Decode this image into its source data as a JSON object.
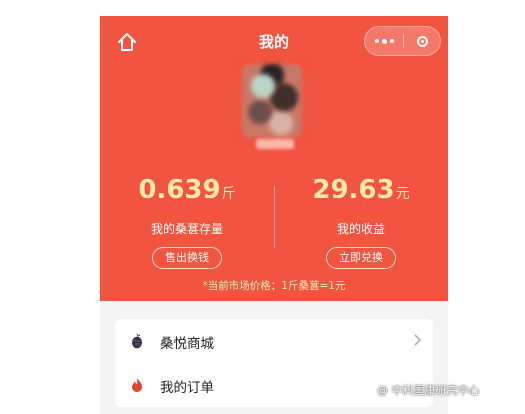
{
  "header": {
    "title": "我的"
  },
  "stats": {
    "storage": {
      "value": "0.639",
      "unit": "斤",
      "label": "我的桑葚存量",
      "button": "售出换钱"
    },
    "income": {
      "value": "29.63",
      "unit": "元",
      "label": "我的收益",
      "button": "立即兑换"
    }
  },
  "market_price": "*当前市场价格：1斤桑葚=1元",
  "menu": {
    "items": [
      {
        "label": "桑悦商城",
        "icon": "mulberry-icon"
      },
      {
        "label": "我的订单",
        "icon": "flame-icon"
      }
    ]
  },
  "watermark": "@ 中科国康研究中心",
  "colors": {
    "header_red": "#f1543f",
    "number_gold": "#ffe9a6",
    "background": "#f4f4f4"
  }
}
